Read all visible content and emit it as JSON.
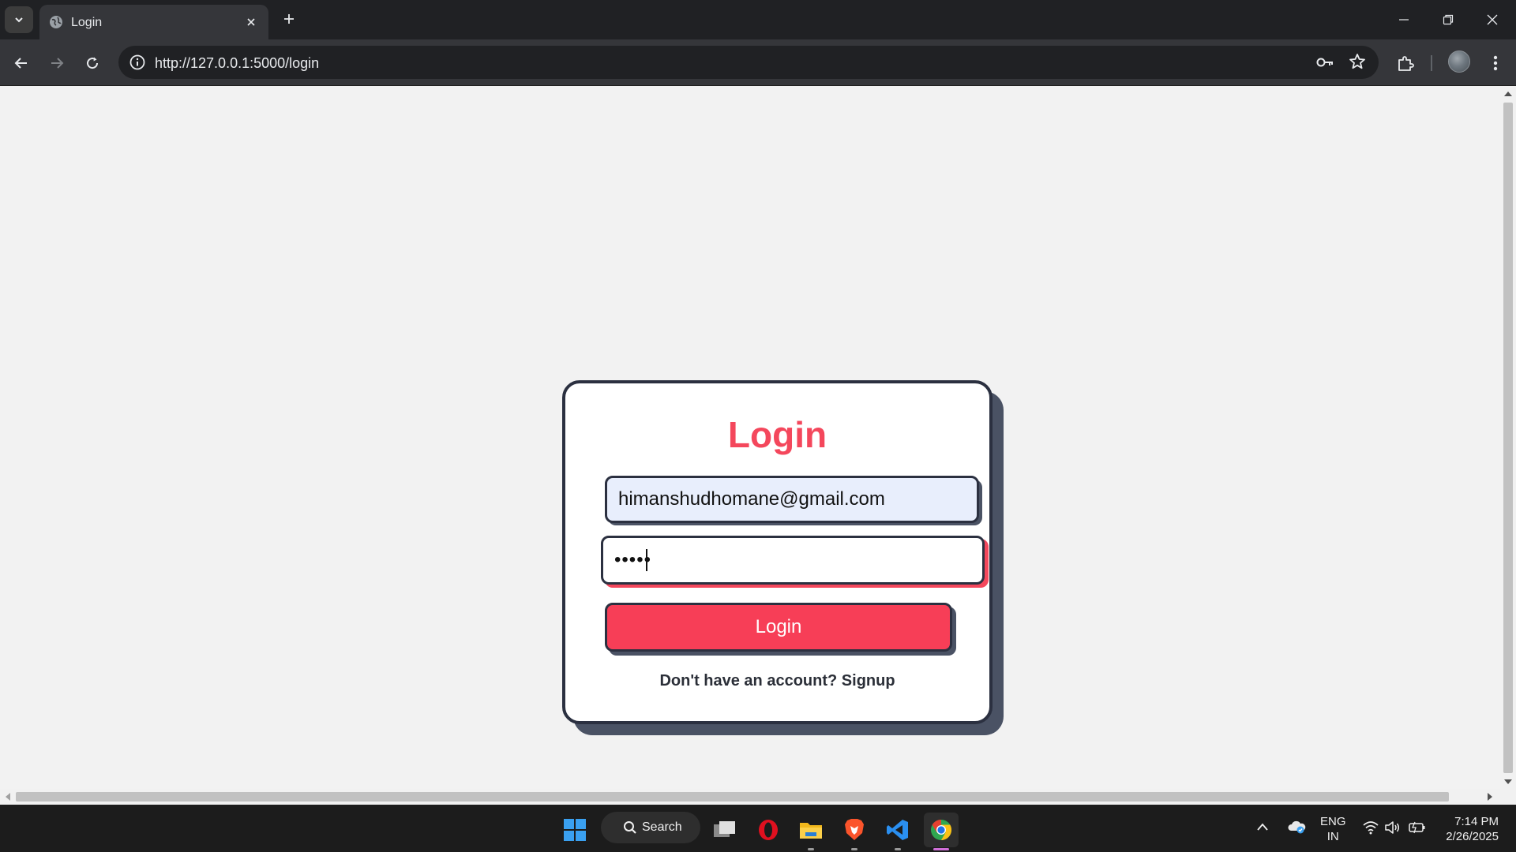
{
  "browser": {
    "tab_title": "Login",
    "url": "http://127.0.0.1:5000/login"
  },
  "login": {
    "title": "Login",
    "email_value": "himanshudhomane@gmail.com",
    "password_masked": "•••••",
    "button_label": "Login",
    "signup_prompt": "Don't have an account?",
    "signup_link": "Signup"
  },
  "colors": {
    "accent": "#f4475c",
    "button": "#f73e57",
    "border": "#2b3040",
    "shadow": "#4a5264",
    "email_bg": "#e8eefc"
  },
  "taskbar": {
    "search_label": "Search",
    "lang_top": "ENG",
    "lang_bottom": "IN",
    "time": "7:14 PM",
    "date": "2/26/2025"
  }
}
